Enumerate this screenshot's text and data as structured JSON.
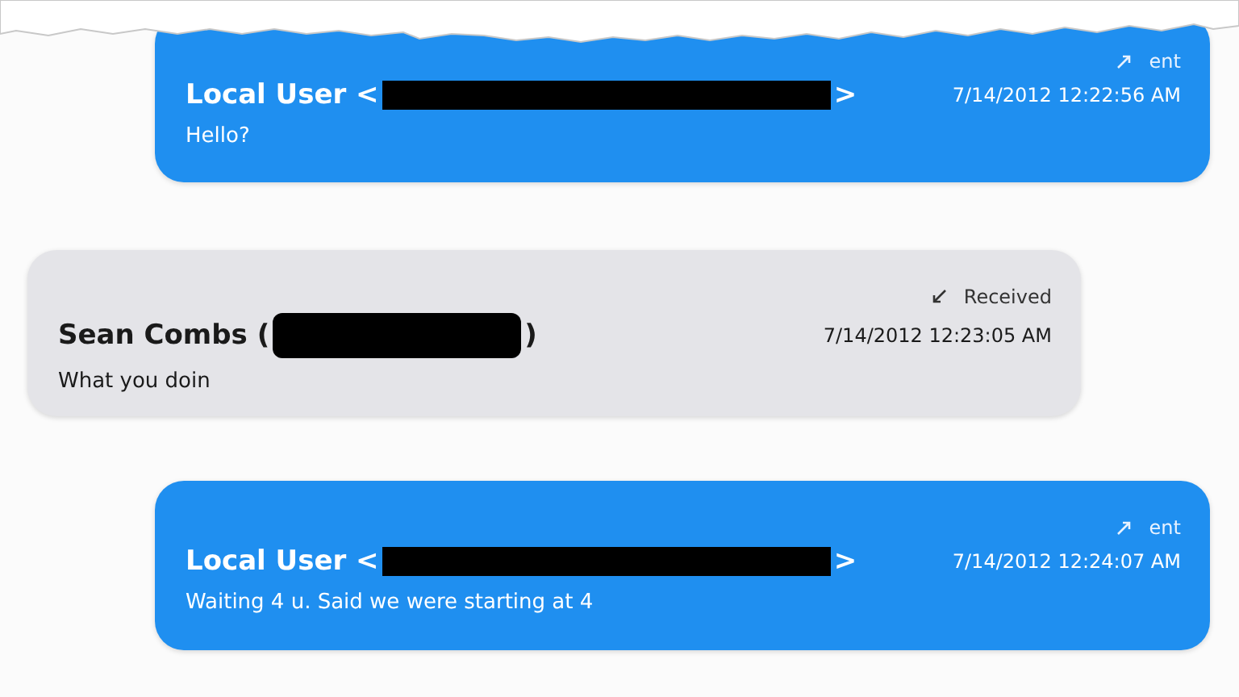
{
  "messages": [
    {
      "kind": "sent",
      "status": "ent",
      "sender_prefix": "Local User <",
      "sender_suffix": ">",
      "time": "7/14/2012 12:22:56 AM",
      "body": "Hello?"
    },
    {
      "kind": "received",
      "status": "Received",
      "sender_prefix": "Sean Combs (",
      "sender_suffix": ")",
      "time": "7/14/2012 12:23:05 AM",
      "body": "What you doin"
    },
    {
      "kind": "sent",
      "status": "ent",
      "sender_prefix": "Local User <",
      "sender_suffix": ">",
      "time": "7/14/2012 12:24:07 AM",
      "body": "Waiting 4 u. Said we were starting at 4"
    }
  ]
}
